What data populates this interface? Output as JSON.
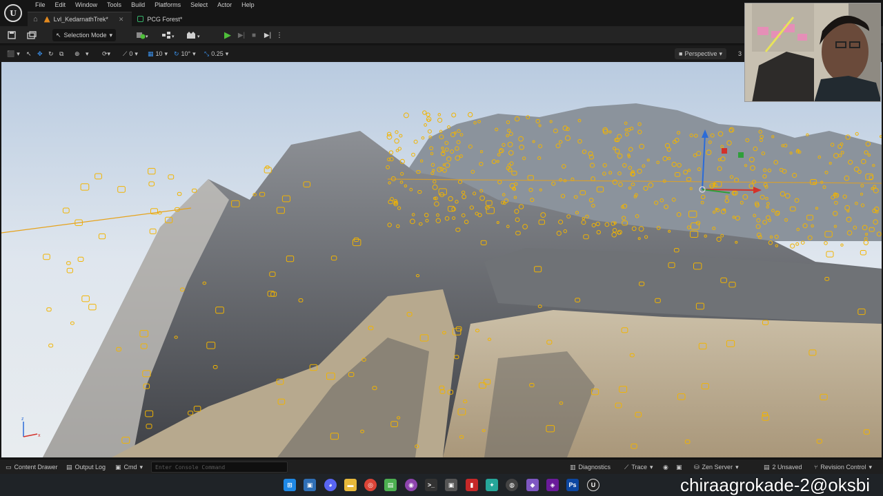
{
  "menu": [
    "File",
    "Edit",
    "Window",
    "Tools",
    "Build",
    "Platforms",
    "Select",
    "Actor",
    "Help"
  ],
  "tabs": [
    {
      "label": "Lvl_KedarnathTrek*",
      "active": true
    },
    {
      "label": "PCG Forest*",
      "active": false
    }
  ],
  "toolbar": {
    "selection_mode": "Selection Mode"
  },
  "viewport_toolbar": {
    "rotation_snap": "0",
    "grid_snap": "10",
    "angle_snap": "10°",
    "scale_snap": "0.25",
    "view_mode": "Perspective",
    "cut_off": "3"
  },
  "statusbar": {
    "content_drawer": "Content Drawer",
    "output_log": "Output Log",
    "cmd": "Cmd",
    "console_placeholder": "Enter Console Command",
    "diagnostics": "Diagnostics",
    "trace": "Trace",
    "zen_server": "Zen Server",
    "unsaved": "2 Unsaved",
    "revision_control": "Revision Control"
  },
  "taskbar": {
    "icons": [
      "windows-start-icon",
      "terminal-icon",
      "discord-icon",
      "file-explorer-icon",
      "chrome-icon",
      "notepad-icon",
      "github-icon",
      "cmd-icon",
      "screenshot-icon",
      "red-app-icon",
      "vscode-blue-icon",
      "obs-icon",
      "visual-studio-icon",
      "davinci-icon",
      "photoshop-icon",
      "unreal-icon"
    ]
  },
  "watermark": "chiraagrokade-2@oksbi",
  "colors": {
    "accent": "#3a8fe8",
    "play": "#4fbf3a",
    "pcg_points": "#f2b400",
    "sky": "#cfdbe8"
  }
}
